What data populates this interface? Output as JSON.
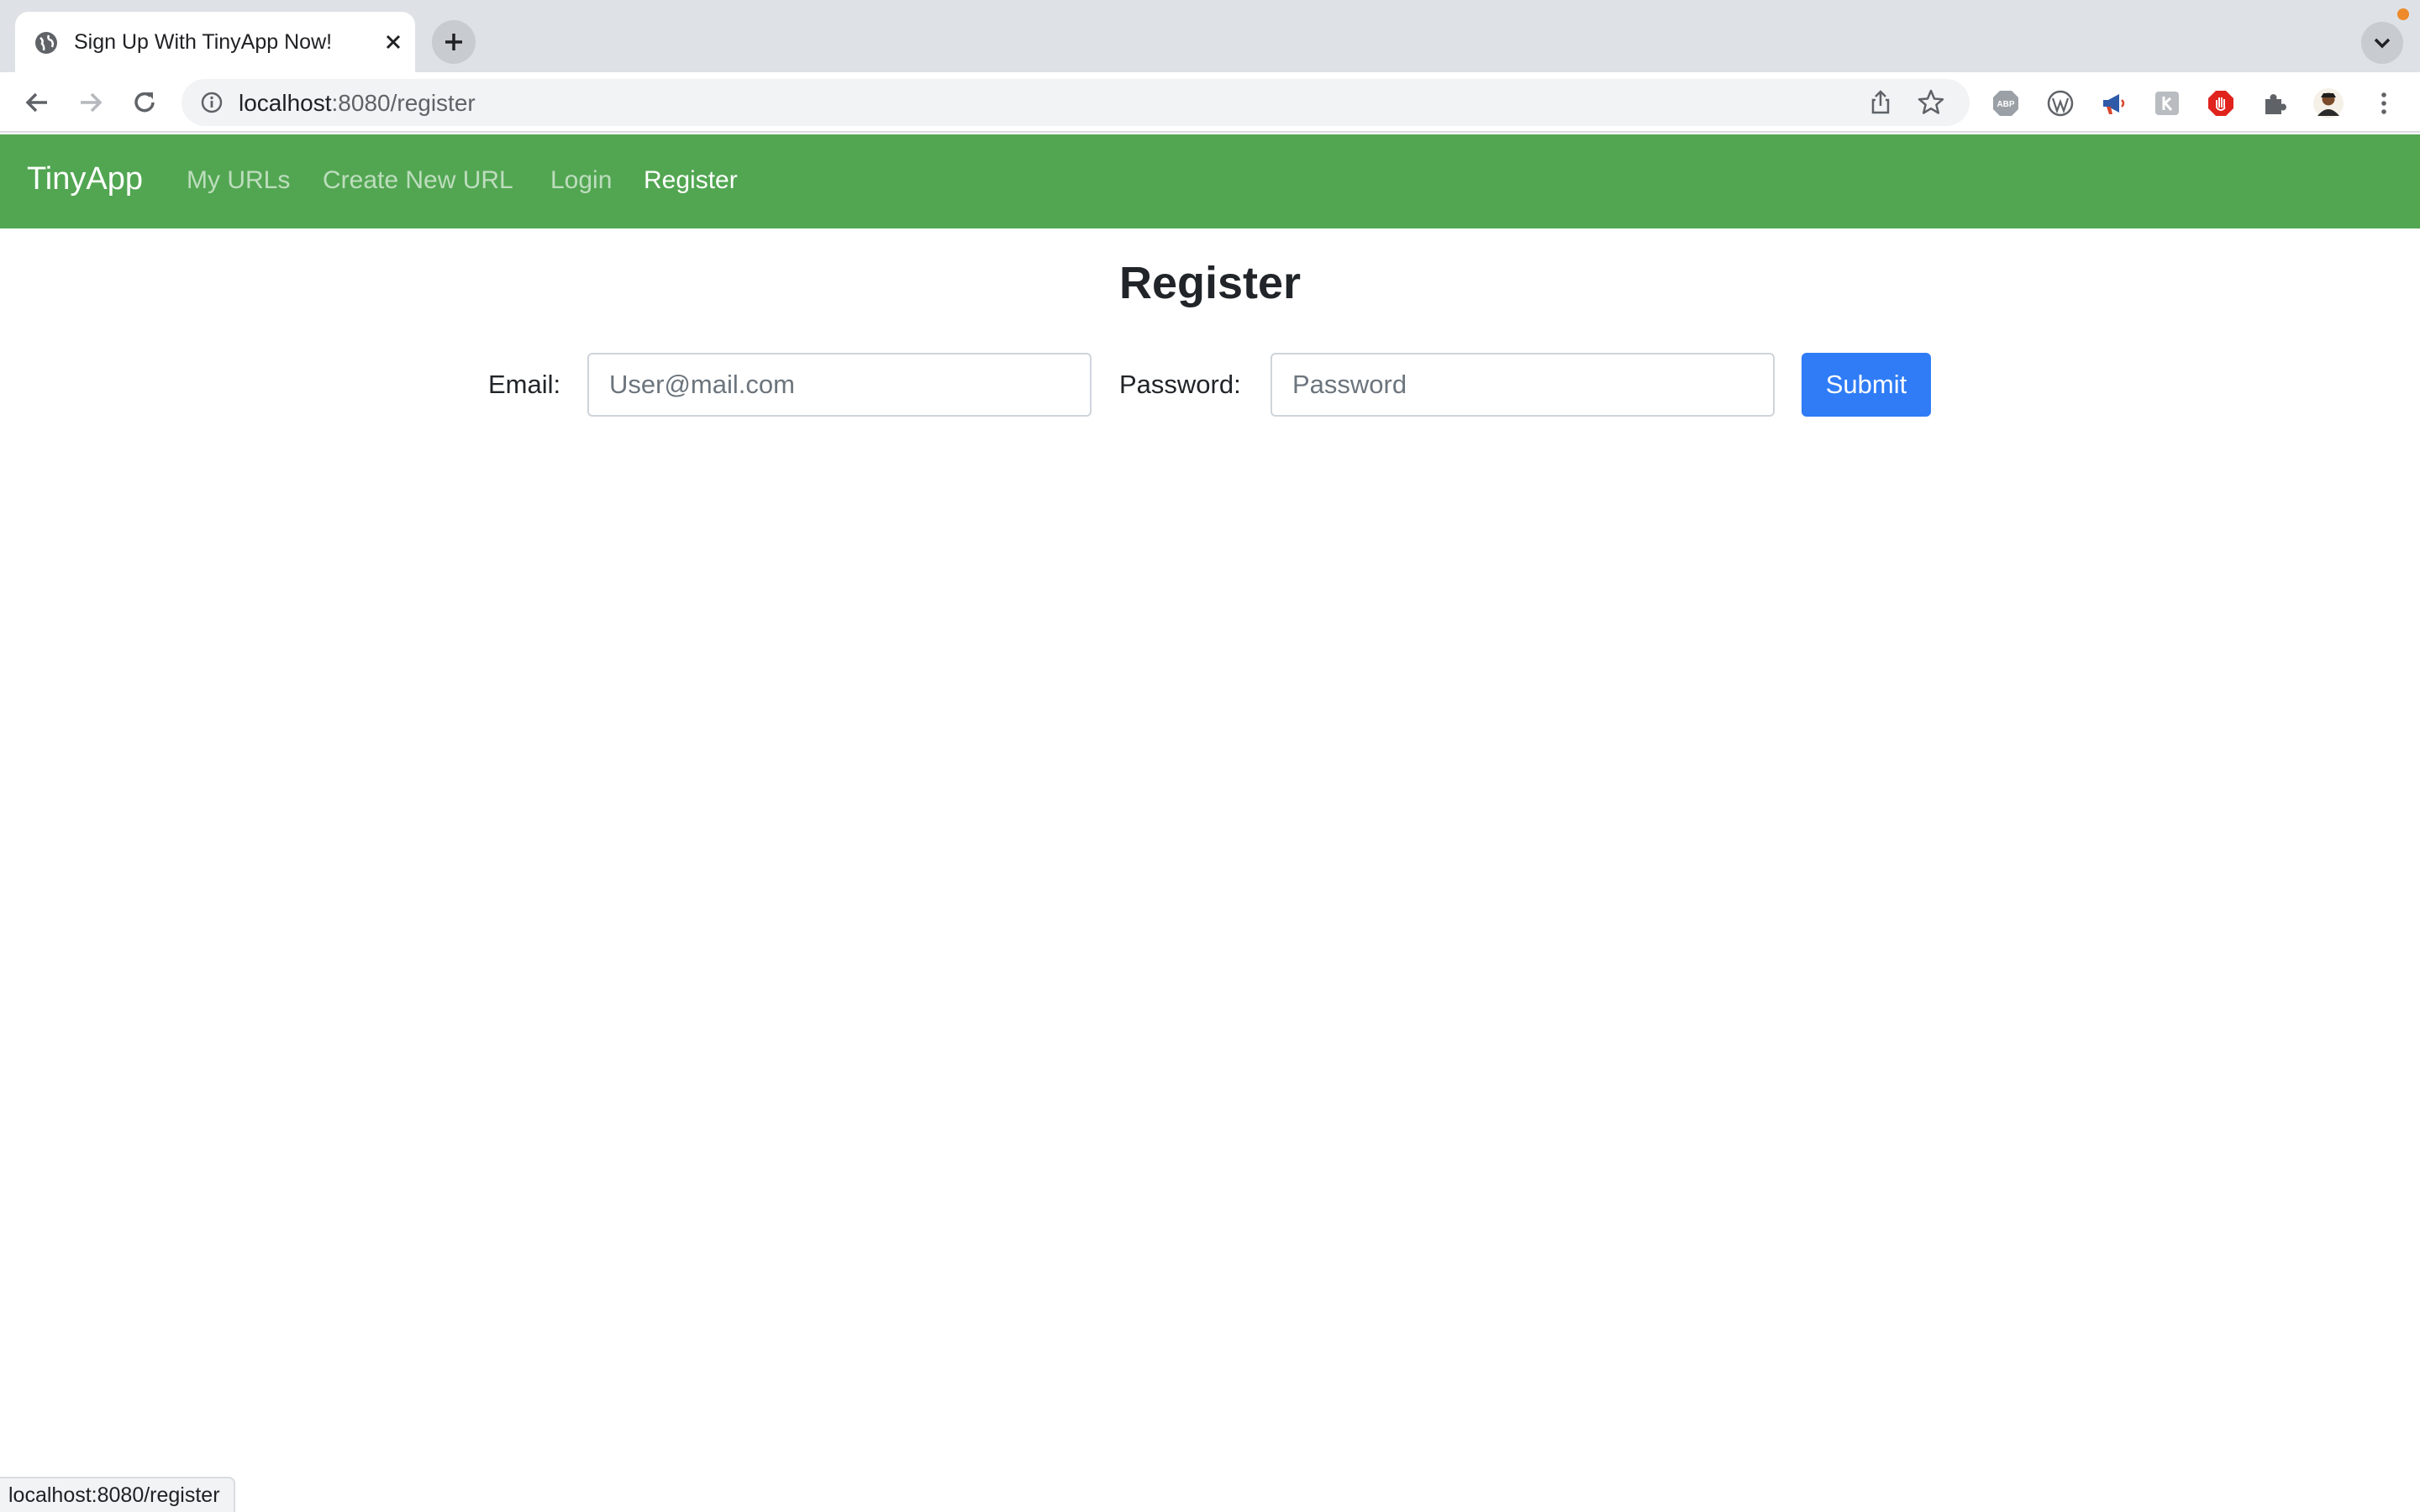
{
  "browser": {
    "tab_title": "Sign Up With TinyApp Now!",
    "url_host": "localhost",
    "url_rest": ":8080/register",
    "status_url": "localhost:8080/register",
    "icons": {
      "tab_favicon": "globe-icon",
      "tab_close": "close-icon",
      "new_tab": "plus-icon",
      "tab_search": "chevron-down-icon",
      "back": "arrow-left-icon",
      "forward": "arrow-right-icon",
      "reload": "reload-icon",
      "site_info": "info-icon",
      "share": "share-icon",
      "bookmark": "star-icon",
      "extensions": [
        "adblock-icon",
        "wordpress-icon",
        "megaphone-icon",
        "ext-icon",
        "stop-icon",
        "puzzle-icon",
        "profile-avatar-icon",
        "menu-dots-icon"
      ]
    }
  },
  "navbar": {
    "brand": "TinyApp",
    "links": [
      {
        "label": "My URLs",
        "active": false
      },
      {
        "label": "Create New URL",
        "active": false
      },
      {
        "label": "Login",
        "active": false
      },
      {
        "label": "Register",
        "active": true
      }
    ],
    "color": "#52a652"
  },
  "form": {
    "title": "Register",
    "email_label": "Email:",
    "email_placeholder": "User@mail.com",
    "email_value": "",
    "password_label": "Password:",
    "password_placeholder": "Password",
    "password_value": "",
    "submit_label": "Submit",
    "submit_color": "#2f7cf6"
  }
}
